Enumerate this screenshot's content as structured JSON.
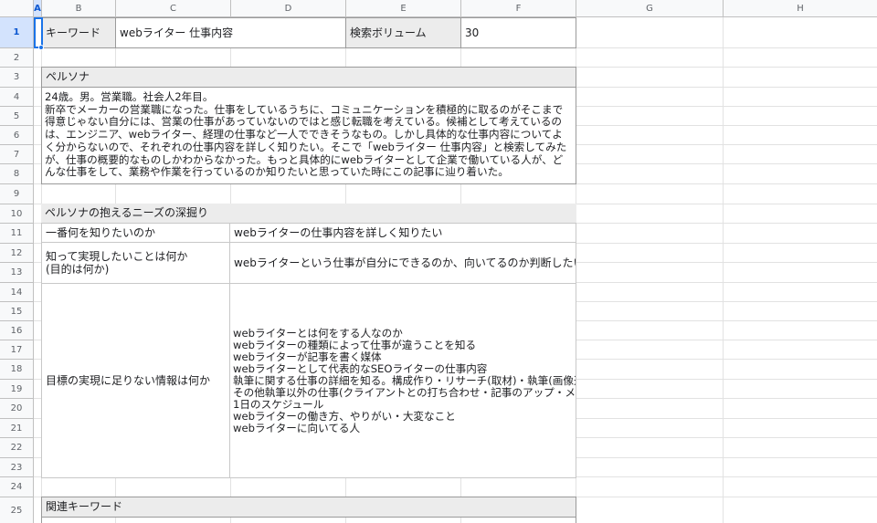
{
  "columns": [
    "A",
    "B",
    "C",
    "D",
    "E",
    "F",
    "G",
    "H"
  ],
  "rows": [
    "1",
    "2",
    "3",
    "4",
    "5",
    "6",
    "7",
    "8",
    "9",
    "10",
    "11",
    "12",
    "13",
    "14",
    "15",
    "16",
    "17",
    "18",
    "19",
    "20",
    "21",
    "22",
    "23",
    "24",
    "25"
  ],
  "row1": {
    "keyword_label": "キーワード",
    "keyword_value": "webライター 仕事内容",
    "volume_label": "検索ボリューム",
    "volume_value": "30"
  },
  "persona": {
    "header": "ペルソナ",
    "text": "24歳。男。営業職。社会人2年目。\n新卒でメーカーの営業職になった。仕事をしているうちに、コミュニケーションを積極的に取るのがそこまで得意じゃない自分には、営業の仕事があっていないのではと感じ転職を考えている。候補として考えているのは、エンジニア、webライター、経理の仕事など一人でできそうなもの。しかし具体的な仕事内容についてよく分からないので、それぞれの仕事内容を詳しく知りたい。そこで「webライター 仕事内容」と検索してみたが、仕事の概要的なものしかわからなかった。もっと具体的にwebライターとして企業で働いている人が、どんな仕事をして、業務や作業を行っているのか知りたいと思っていた時にこの記事に辿り着いた。"
  },
  "needs": {
    "header": "ペルソナの抱えるニーズの深掘り",
    "q1_label": "一番何を知りたいのか",
    "q1_value": "webライターの仕事内容を詳しく知りたい",
    "q2_label": "知って実現したいことは何か\n(目的は何か)",
    "q2_value": "webライターという仕事が自分にできるのか、向いてるのか判断したい",
    "q3_label": "目標の実現に足りない情報は何か",
    "q3_value": "webライターとは何をする人なのか\nwebライターの種類によって仕事が違うことを知る\nwebライターが記事を書く媒体\nwebライターとして代表的なSEOライターの仕事内容\n執筆に関する仕事の詳細を知る。構成作り・リサーチ(取材)・執筆(画像選定\nその他執筆以外の仕事(クライアントとの打ち合わせ・記事のアップ・メディ\n1日のスケジュール\nwebライターの働き方、やりがい・大変なこと\nwebライターに向いてる人"
  },
  "related": {
    "header": "関連キーワード"
  }
}
